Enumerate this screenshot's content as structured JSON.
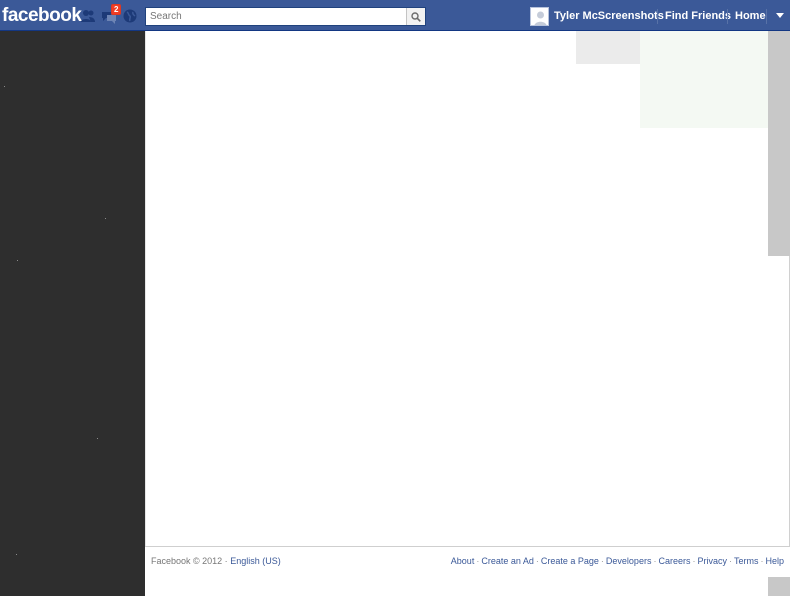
{
  "header": {
    "logo": "facebook",
    "notifications": {
      "friend_requests_icon": "friends-icon",
      "messages_icon": "messages-icon",
      "messages_badge": "2",
      "notifications_icon": "globe-icon"
    },
    "search": {
      "placeholder": "Search",
      "value": ""
    },
    "user_name": "Tyler McScreenshots",
    "find_friends": "Find Friends",
    "home": "Home",
    "account_menu_icon": "chevron-down-icon"
  },
  "footer": {
    "copyright": "Facebook © 2012 · ",
    "language": "English (US)",
    "links": [
      "About",
      "Create an Ad",
      "Create a Page",
      "Developers",
      "Careers",
      "Privacy",
      "Terms",
      "Help"
    ]
  },
  "colors": {
    "brand_blue": "#3b5998",
    "sidebar": "#2e2e2e",
    "badge_red": "#f03d25"
  }
}
